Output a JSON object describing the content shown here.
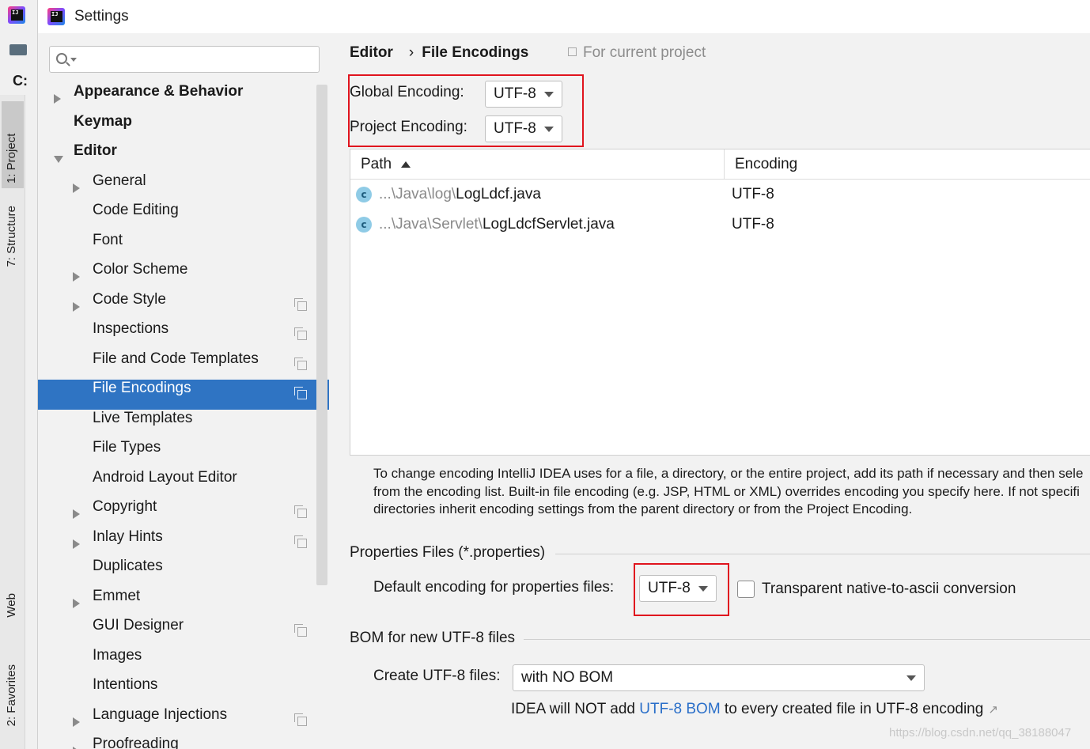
{
  "window": {
    "title": "Settings"
  },
  "ide": {
    "drive": "C:",
    "tool_tabs": [
      "1: Project",
      "7: Structure",
      "Web",
      "2: Favorites"
    ]
  },
  "nav": {
    "search_placeholder": "",
    "items": [
      {
        "label": "Appearance & Behavior",
        "level": 0,
        "arrow": "right",
        "copy": false
      },
      {
        "label": "Keymap",
        "level": 0,
        "arrow": "none",
        "copy": false
      },
      {
        "label": "Editor",
        "level": 0,
        "arrow": "down",
        "copy": false
      },
      {
        "label": "General",
        "level": 1,
        "arrow": "right",
        "copy": false
      },
      {
        "label": "Code Editing",
        "level": 1,
        "arrow": "none",
        "copy": false
      },
      {
        "label": "Font",
        "level": 1,
        "arrow": "none",
        "copy": false
      },
      {
        "label": "Color Scheme",
        "level": 1,
        "arrow": "right",
        "copy": false
      },
      {
        "label": "Code Style",
        "level": 1,
        "arrow": "right",
        "copy": true
      },
      {
        "label": "Inspections",
        "level": 1,
        "arrow": "none",
        "copy": true
      },
      {
        "label": "File and Code Templates",
        "level": 1,
        "arrow": "none",
        "copy": true
      },
      {
        "label": "File Encodings",
        "level": 1,
        "arrow": "none",
        "copy": true,
        "selected": true
      },
      {
        "label": "Live Templates",
        "level": 1,
        "arrow": "none",
        "copy": false
      },
      {
        "label": "File Types",
        "level": 1,
        "arrow": "none",
        "copy": false
      },
      {
        "label": "Android Layout Editor",
        "level": 1,
        "arrow": "none",
        "copy": false
      },
      {
        "label": "Copyright",
        "level": 1,
        "arrow": "right",
        "copy": true
      },
      {
        "label": "Inlay Hints",
        "level": 1,
        "arrow": "right",
        "copy": true
      },
      {
        "label": "Duplicates",
        "level": 1,
        "arrow": "none",
        "copy": false
      },
      {
        "label": "Emmet",
        "level": 1,
        "arrow": "right",
        "copy": false
      },
      {
        "label": "GUI Designer",
        "level": 1,
        "arrow": "none",
        "copy": true
      },
      {
        "label": "Images",
        "level": 1,
        "arrow": "none",
        "copy": false
      },
      {
        "label": "Intentions",
        "level": 1,
        "arrow": "none",
        "copy": false
      },
      {
        "label": "Language Injections",
        "level": 1,
        "arrow": "right",
        "copy": true
      },
      {
        "label": "Proofreading",
        "level": 1,
        "arrow": "right",
        "copy": false
      }
    ]
  },
  "breadcrumb": {
    "parent": "Editor",
    "separator": "›",
    "current": "File Encodings"
  },
  "scope_note": "For current project",
  "global_encoding": {
    "label": "Global Encoding:",
    "value": "UTF-8"
  },
  "project_encoding": {
    "label": "Project Encoding:",
    "value": "UTF-8"
  },
  "table": {
    "columns": {
      "path": "Path",
      "encoding": "Encoding"
    },
    "rows": [
      {
        "dim": "...\\Java\\log\\",
        "name": "LogLdcf.java",
        "encoding": "UTF-8"
      },
      {
        "dim": "...\\Java\\Servlet\\",
        "name": "LogLdcfServlet.java",
        "encoding": "UTF-8"
      }
    ]
  },
  "help": {
    "line1": "To change encoding IntelliJ IDEA uses for a file, a directory, or the entire project, add its path if necessary and then sele",
    "line2": "from the encoding list. Built-in file encoding (e.g. JSP, HTML or XML) overrides encoding you specify here. If not specifi",
    "line3": "directories inherit encoding settings from the parent directory or from the Project Encoding."
  },
  "properties": {
    "title": "Properties Files (*.properties)",
    "default_label": "Default encoding for properties files:",
    "default_value": "UTF-8",
    "checkbox_label": "Transparent native-to-ascii conversion",
    "checkbox_checked": false
  },
  "bom": {
    "title": "BOM for new UTF-8 files",
    "create_label": "Create UTF-8 files:",
    "create_value": "with NO BOM",
    "note_pre": "IDEA will NOT add ",
    "note_link": "UTF-8 BOM",
    "note_post": " to every created file in UTF-8 encoding",
    "note_arrow": "↗"
  },
  "watermark": "https://blog.csdn.net/qq_38188047",
  "colors": {
    "selection": "#2f74c3",
    "highlight": "#e0141e",
    "link": "#2a6fc9"
  }
}
